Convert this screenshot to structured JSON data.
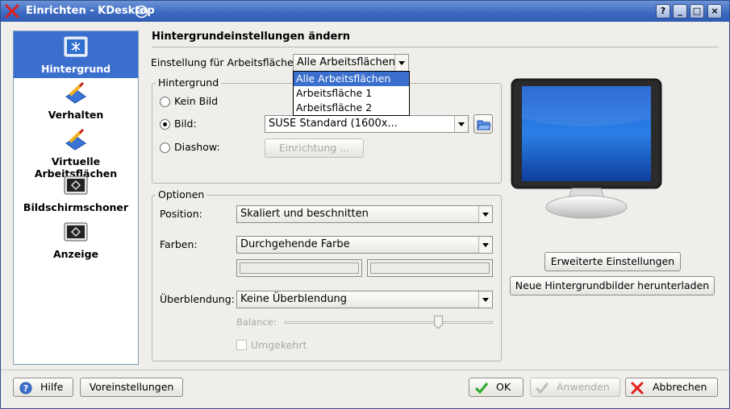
{
  "window": {
    "title": "Einrichten - KDesktop",
    "buttons": [
      "?",
      "_",
      "□",
      "×"
    ]
  },
  "sidebar": {
    "items": [
      {
        "label": "Hintergrund",
        "icon": "desktop-background-icon",
        "selected": true
      },
      {
        "label": "Verhalten",
        "icon": "desktop-behavior-icon",
        "selected": false
      },
      {
        "label": "Virtuelle Arbeitsflächen",
        "icon": "virtual-desktops-icon",
        "selected": false
      },
      {
        "label": "Bildschirmschoner",
        "icon": "screensaver-icon",
        "selected": false
      },
      {
        "label": "Anzeige",
        "icon": "display-icon",
        "selected": false
      }
    ]
  },
  "main": {
    "heading": "Hintergrundeinstellungen ändern",
    "desktop_label": "Einstellung für Arbeitsfläche:",
    "desktop_value": "Alle Arbeitsflächen",
    "desktop_options": [
      "Alle Arbeitsflächen",
      "Arbeitsfläche 1",
      "Arbeitsfläche 2"
    ],
    "background_group": {
      "title": "Hintergrund",
      "radio_none": "Kein Bild",
      "radio_image": "Bild:",
      "radio_slideshow": "Diashow:",
      "selected_radio": "Bild:",
      "image_value": "SUSE Standard (1600x...",
      "setup_button": "Einrichtung ..."
    },
    "options_group": {
      "title": "Optionen",
      "position_label": "Position:",
      "position_value": "Skaliert und beschnitten",
      "colors_label": "Farben:",
      "colors_value": "Durchgehende Farbe",
      "blending_label": "Überblendung:",
      "blending_value": "Keine Überblendung",
      "balance_label": "Balance:",
      "balance_level": 0.75,
      "reverse_label": "Umgekehrt"
    },
    "advanced_button": "Erweiterte Einstellungen",
    "download_button": "Neue Hintergrundbilder herunterladen"
  },
  "footer": {
    "help": "Hilfe",
    "defaults": "Voreinstellungen",
    "ok": "OK",
    "apply": "Anwenden",
    "cancel": "Abbrechen"
  },
  "colors": {
    "titlebar": "#3d6bc2",
    "selection": "#3b6fce",
    "window_bg": "#efeeea"
  }
}
